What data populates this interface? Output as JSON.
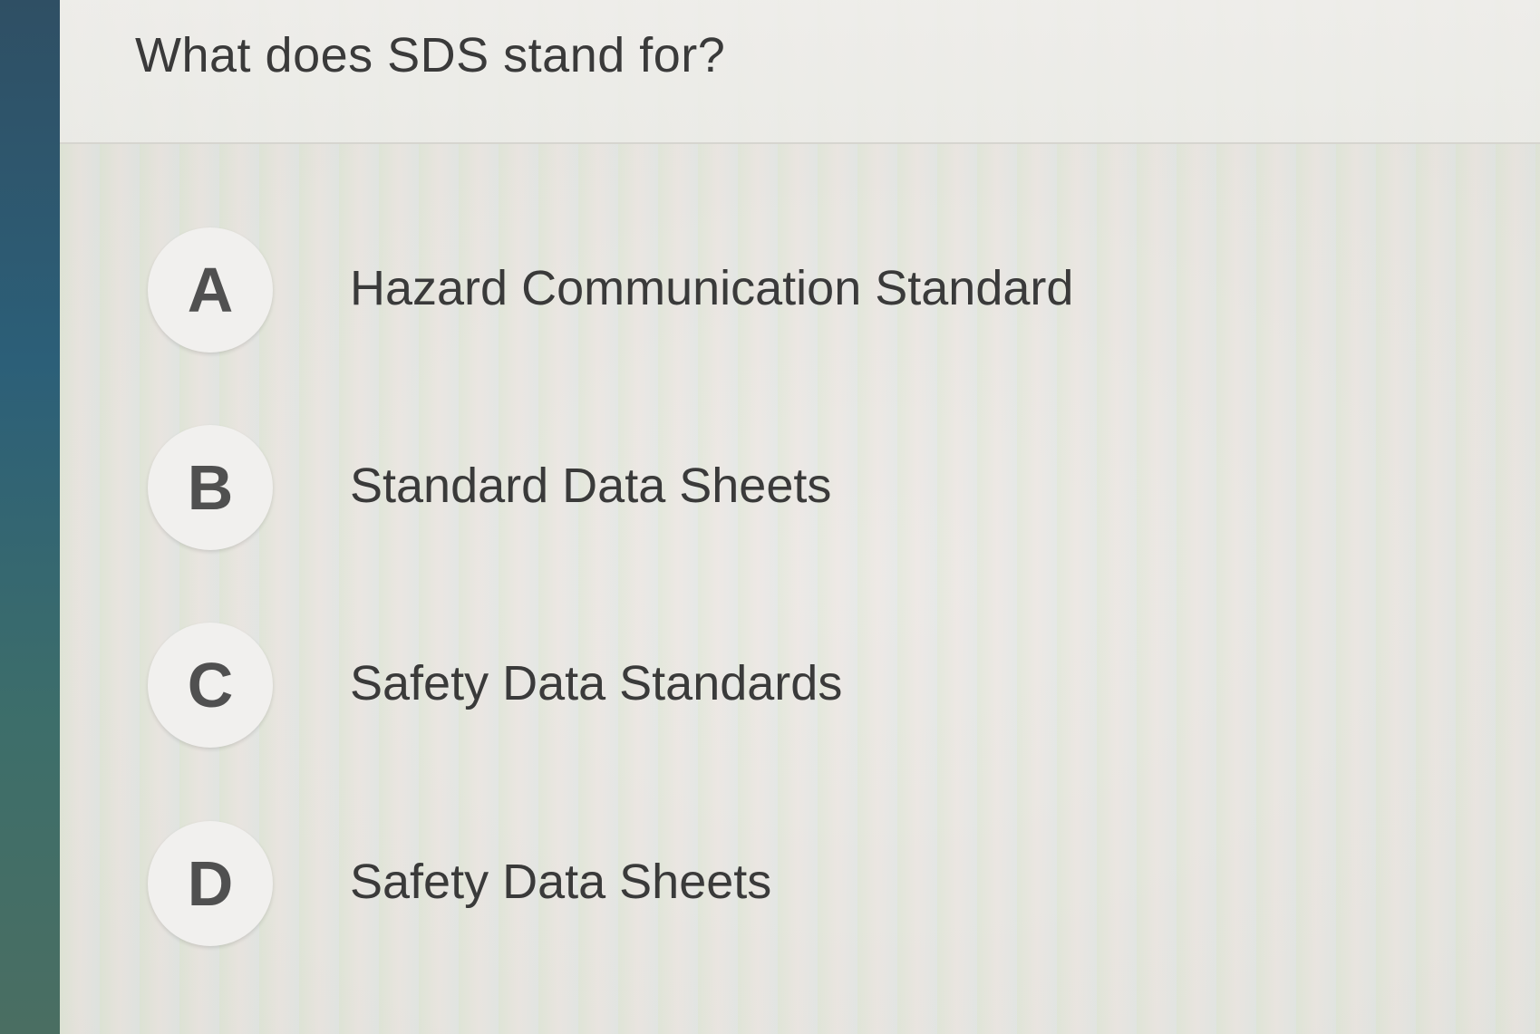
{
  "question": {
    "text": "What does SDS stand for?"
  },
  "options": [
    {
      "letter": "A",
      "text": "Hazard Communication Standard"
    },
    {
      "letter": "B",
      "text": "Standard Data Sheets"
    },
    {
      "letter": "C",
      "text": "Safety Data Standards"
    },
    {
      "letter": "D",
      "text": "Safety Data Sheets"
    }
  ],
  "colors": {
    "text": "#3a3a3a",
    "badge_background": "#f1f0ee",
    "badge_letter": "#505050",
    "left_edge": "#2c5f78"
  }
}
